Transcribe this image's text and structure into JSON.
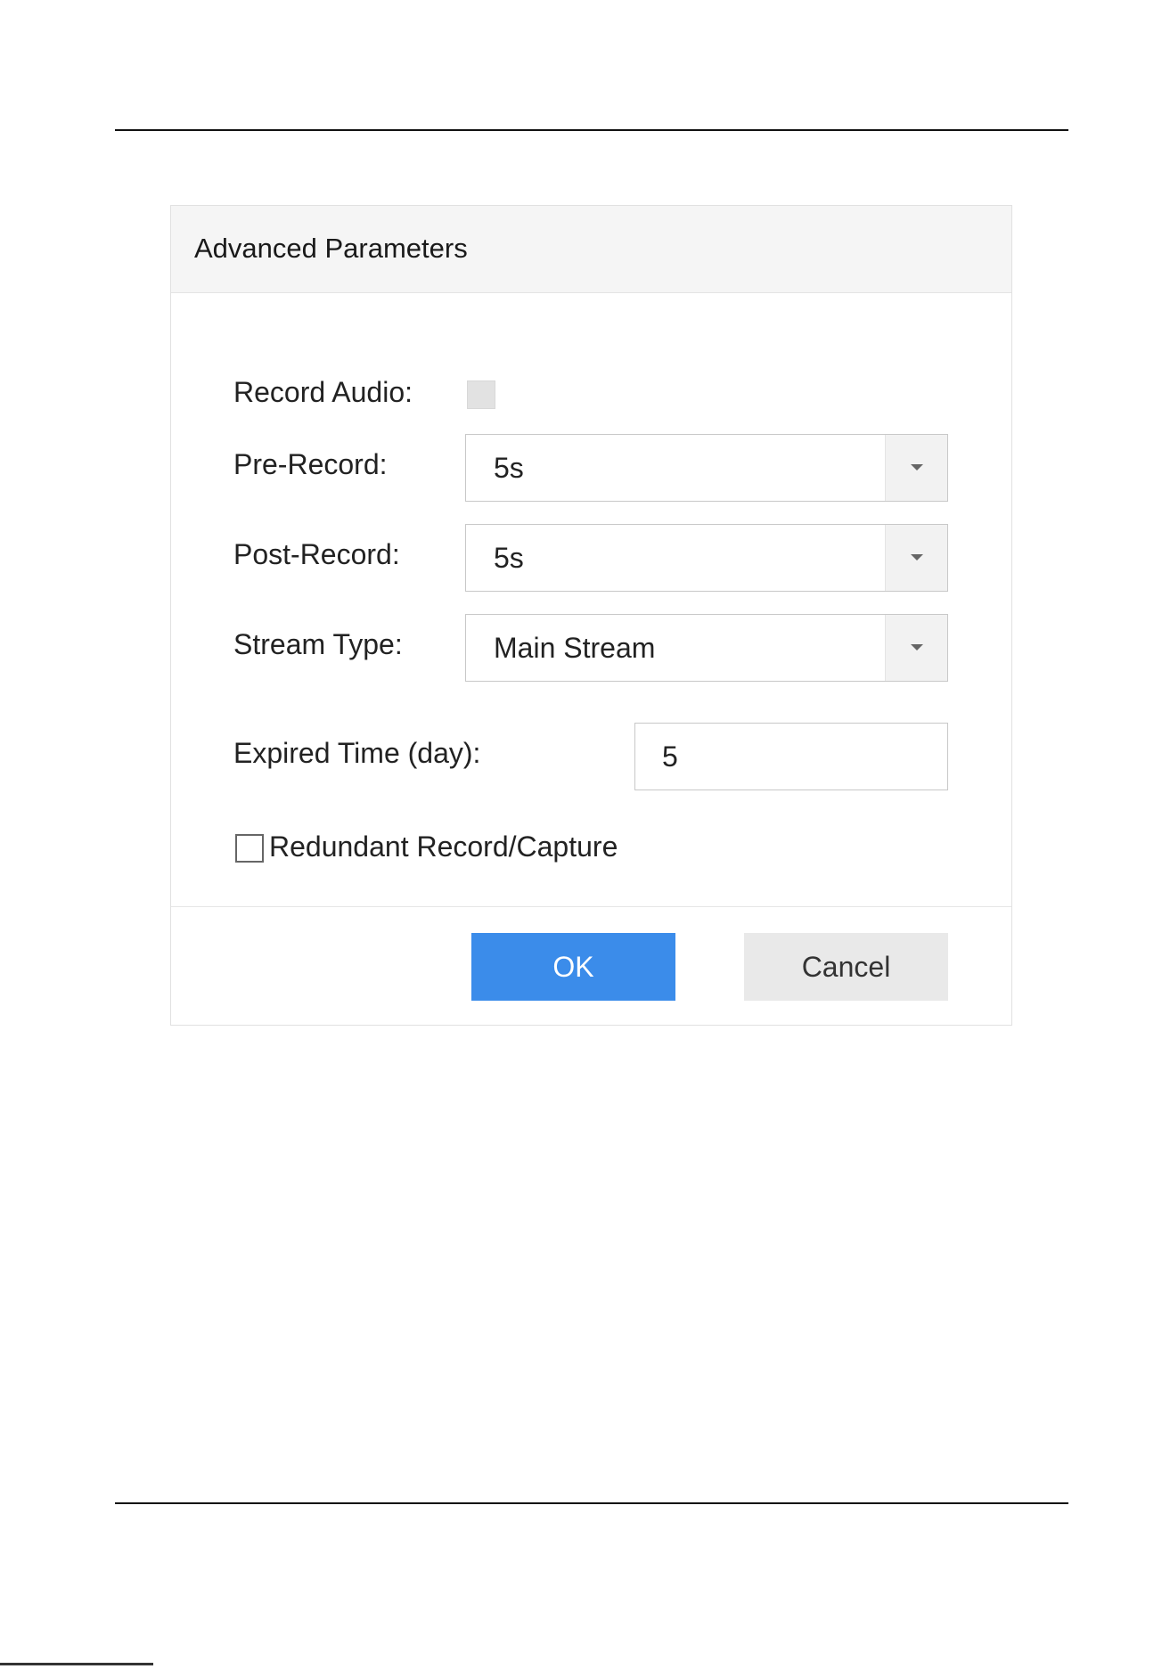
{
  "dialog": {
    "title": "Advanced Parameters",
    "record_audio": {
      "label": "Record Audio:",
      "checked": false
    },
    "pre_record": {
      "label": "Pre-Record:",
      "value": "5s"
    },
    "post_record": {
      "label": "Post-Record:",
      "value": "5s"
    },
    "stream_type": {
      "label": "Stream Type:",
      "value": "Main Stream"
    },
    "expired_time": {
      "label": "Expired Time (day):",
      "value": "5"
    },
    "redundant": {
      "label": "Redundant Record/Capture",
      "checked": false
    },
    "buttons": {
      "ok": "OK",
      "cancel": "Cancel"
    }
  },
  "colors": {
    "primary_button": "#3b8cea",
    "secondary_button": "#e9e9e9",
    "header_background": "#f5f5f5"
  },
  "icons": {
    "dropdown": "chevron-down-icon",
    "checkbox": "checkbox-icon"
  }
}
